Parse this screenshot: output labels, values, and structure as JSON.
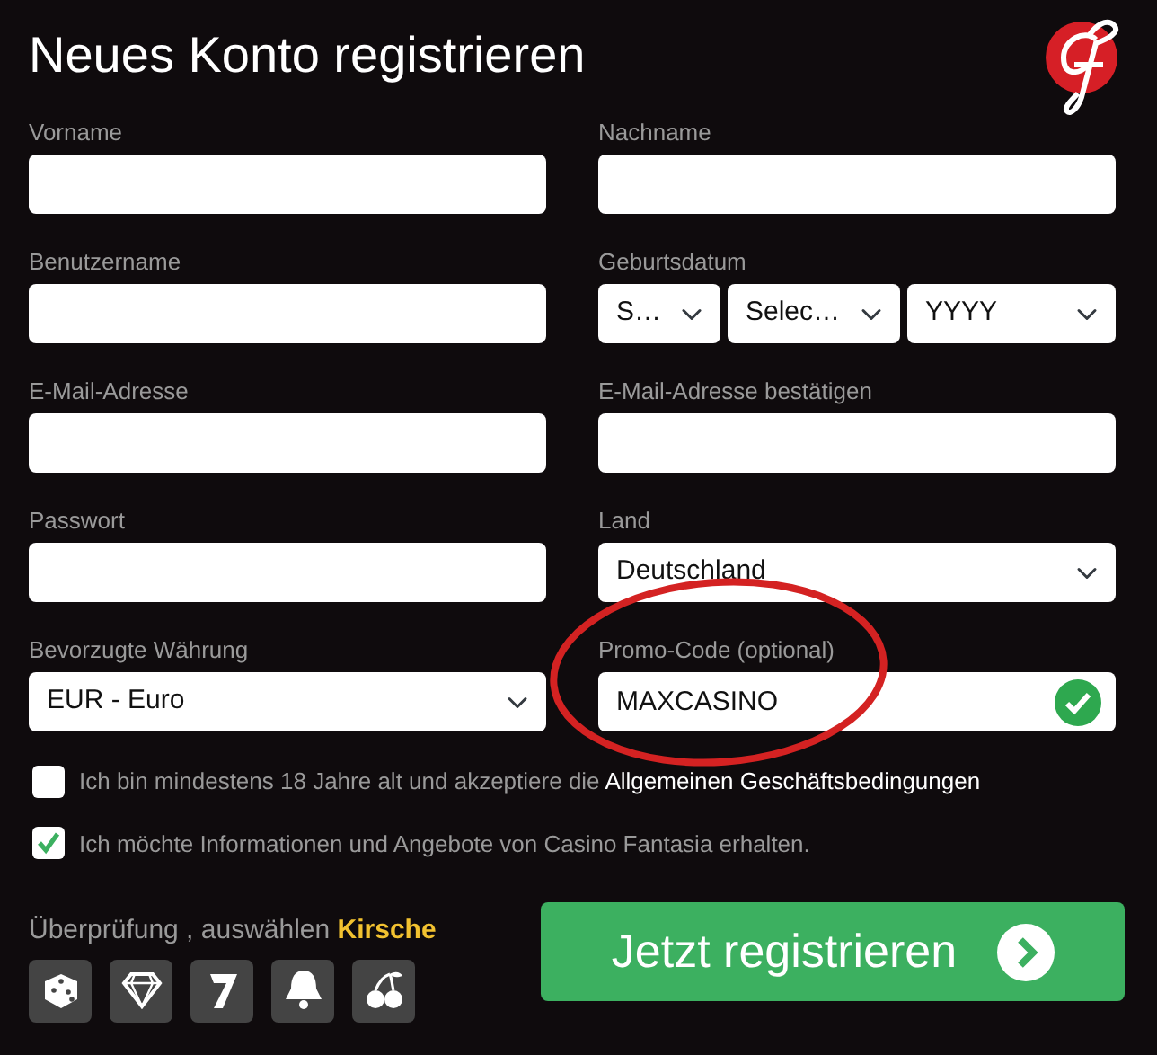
{
  "title": "Neues Konto registrieren",
  "rows": [
    {
      "left": {
        "kind": "text",
        "label": "Vorname"
      },
      "right": {
        "kind": "text",
        "label": "Nachname"
      }
    },
    {
      "left": {
        "kind": "text",
        "label": "Benutzername"
      },
      "right": {
        "kind": "date",
        "label": "Geburtsdatum",
        "parts": [
          "S…",
          "Selec…",
          "YYYY"
        ]
      }
    },
    {
      "left": {
        "kind": "text",
        "label": "E-Mail-Adresse"
      },
      "right": {
        "kind": "text",
        "label": "E-Mail-Adresse bestätigen"
      }
    },
    {
      "left": {
        "kind": "password",
        "label": "Passwort"
      },
      "right": {
        "kind": "select",
        "label": "Land",
        "value": "Deutschland"
      }
    },
    {
      "left": {
        "kind": "select",
        "label": "Bevorzugte Währung",
        "value": "EUR - Euro"
      },
      "right": {
        "kind": "text",
        "label": "Promo-Code (optional)",
        "value": "MAXCASINO",
        "valid": true
      }
    }
  ],
  "checkboxes": [
    {
      "text": "Ich bin mindestens 18 Jahre alt und akzeptiere die",
      "link": "Allgemeinen Geschäftsbedingungen",
      "checked": false
    },
    {
      "text": "Ich möchte Informationen und Angebote von Casino Fantasia erhalten.",
      "checked": true
    }
  ],
  "captcha": {
    "prompt": "Überprüfung , auswählen",
    "target": "Kirsche"
  },
  "submit": "Jetzt registrieren"
}
